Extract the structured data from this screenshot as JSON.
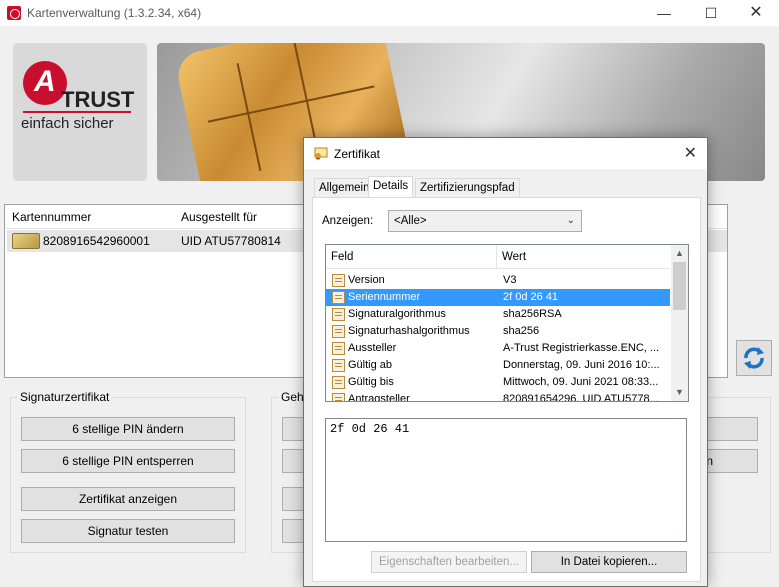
{
  "main_window": {
    "title": "Kartenverwaltung (1.3.2.34, x64)",
    "logo": {
      "brand": "TRUST",
      "tagline": "einfach sicher",
      "accent": "#c8102e"
    },
    "card_list": {
      "columns": [
        "Kartennummer",
        "Ausgestellt für"
      ],
      "rows": [
        {
          "kartennummer": "8208916542960001",
          "ausgestellt_fuer": "UID ATU57780814"
        }
      ]
    },
    "signatur_group": {
      "title": "Signaturzertifikat",
      "buttons": [
        "6 stellige PIN ändern",
        "6 stellige PIN entsperren",
        "Zertifikat anzeigen",
        "Signatur testen"
      ]
    },
    "second_group": {
      "title_visible": "Gehe"
    },
    "right_partial": {
      "text_visible": "n"
    }
  },
  "dialog": {
    "title": "Zertifikat",
    "tabs": [
      "Allgemein",
      "Details",
      "Zertifizierungspfad"
    ],
    "active_tab": "Details",
    "anzeigen_label": "Anzeigen:",
    "anzeigen_value": "<Alle>",
    "list_headers": {
      "feld": "Feld",
      "wert": "Wert"
    },
    "fields": [
      {
        "feld": "Version",
        "wert": "V3",
        "selected": false
      },
      {
        "feld": "Seriennummer",
        "wert": "2f 0d 26 41",
        "selected": true
      },
      {
        "feld": "Signaturalgorithmus",
        "wert": "sha256RSA",
        "selected": false
      },
      {
        "feld": "Signaturhashalgorithmus",
        "wert": "sha256",
        "selected": false
      },
      {
        "feld": "Aussteller",
        "wert": "A-Trust Registrierkasse.ENC, ...",
        "selected": false
      },
      {
        "feld": "Gültig ab",
        "wert": "Donnerstag, 09. Juni 2016 10:...",
        "selected": false
      },
      {
        "feld": "Gültig bis",
        "wert": "Mittwoch, 09. Juni 2021 08:33...",
        "selected": false
      },
      {
        "feld": "Antragsteller",
        "wert": "820891654296, UID ATU5778...",
        "selected": false
      }
    ],
    "value_text": "2f 0d 26 41",
    "buttons": {
      "eigenschaften": "Eigenschaften bearbeiten...",
      "kopieren": "In Datei kopieren..."
    }
  }
}
